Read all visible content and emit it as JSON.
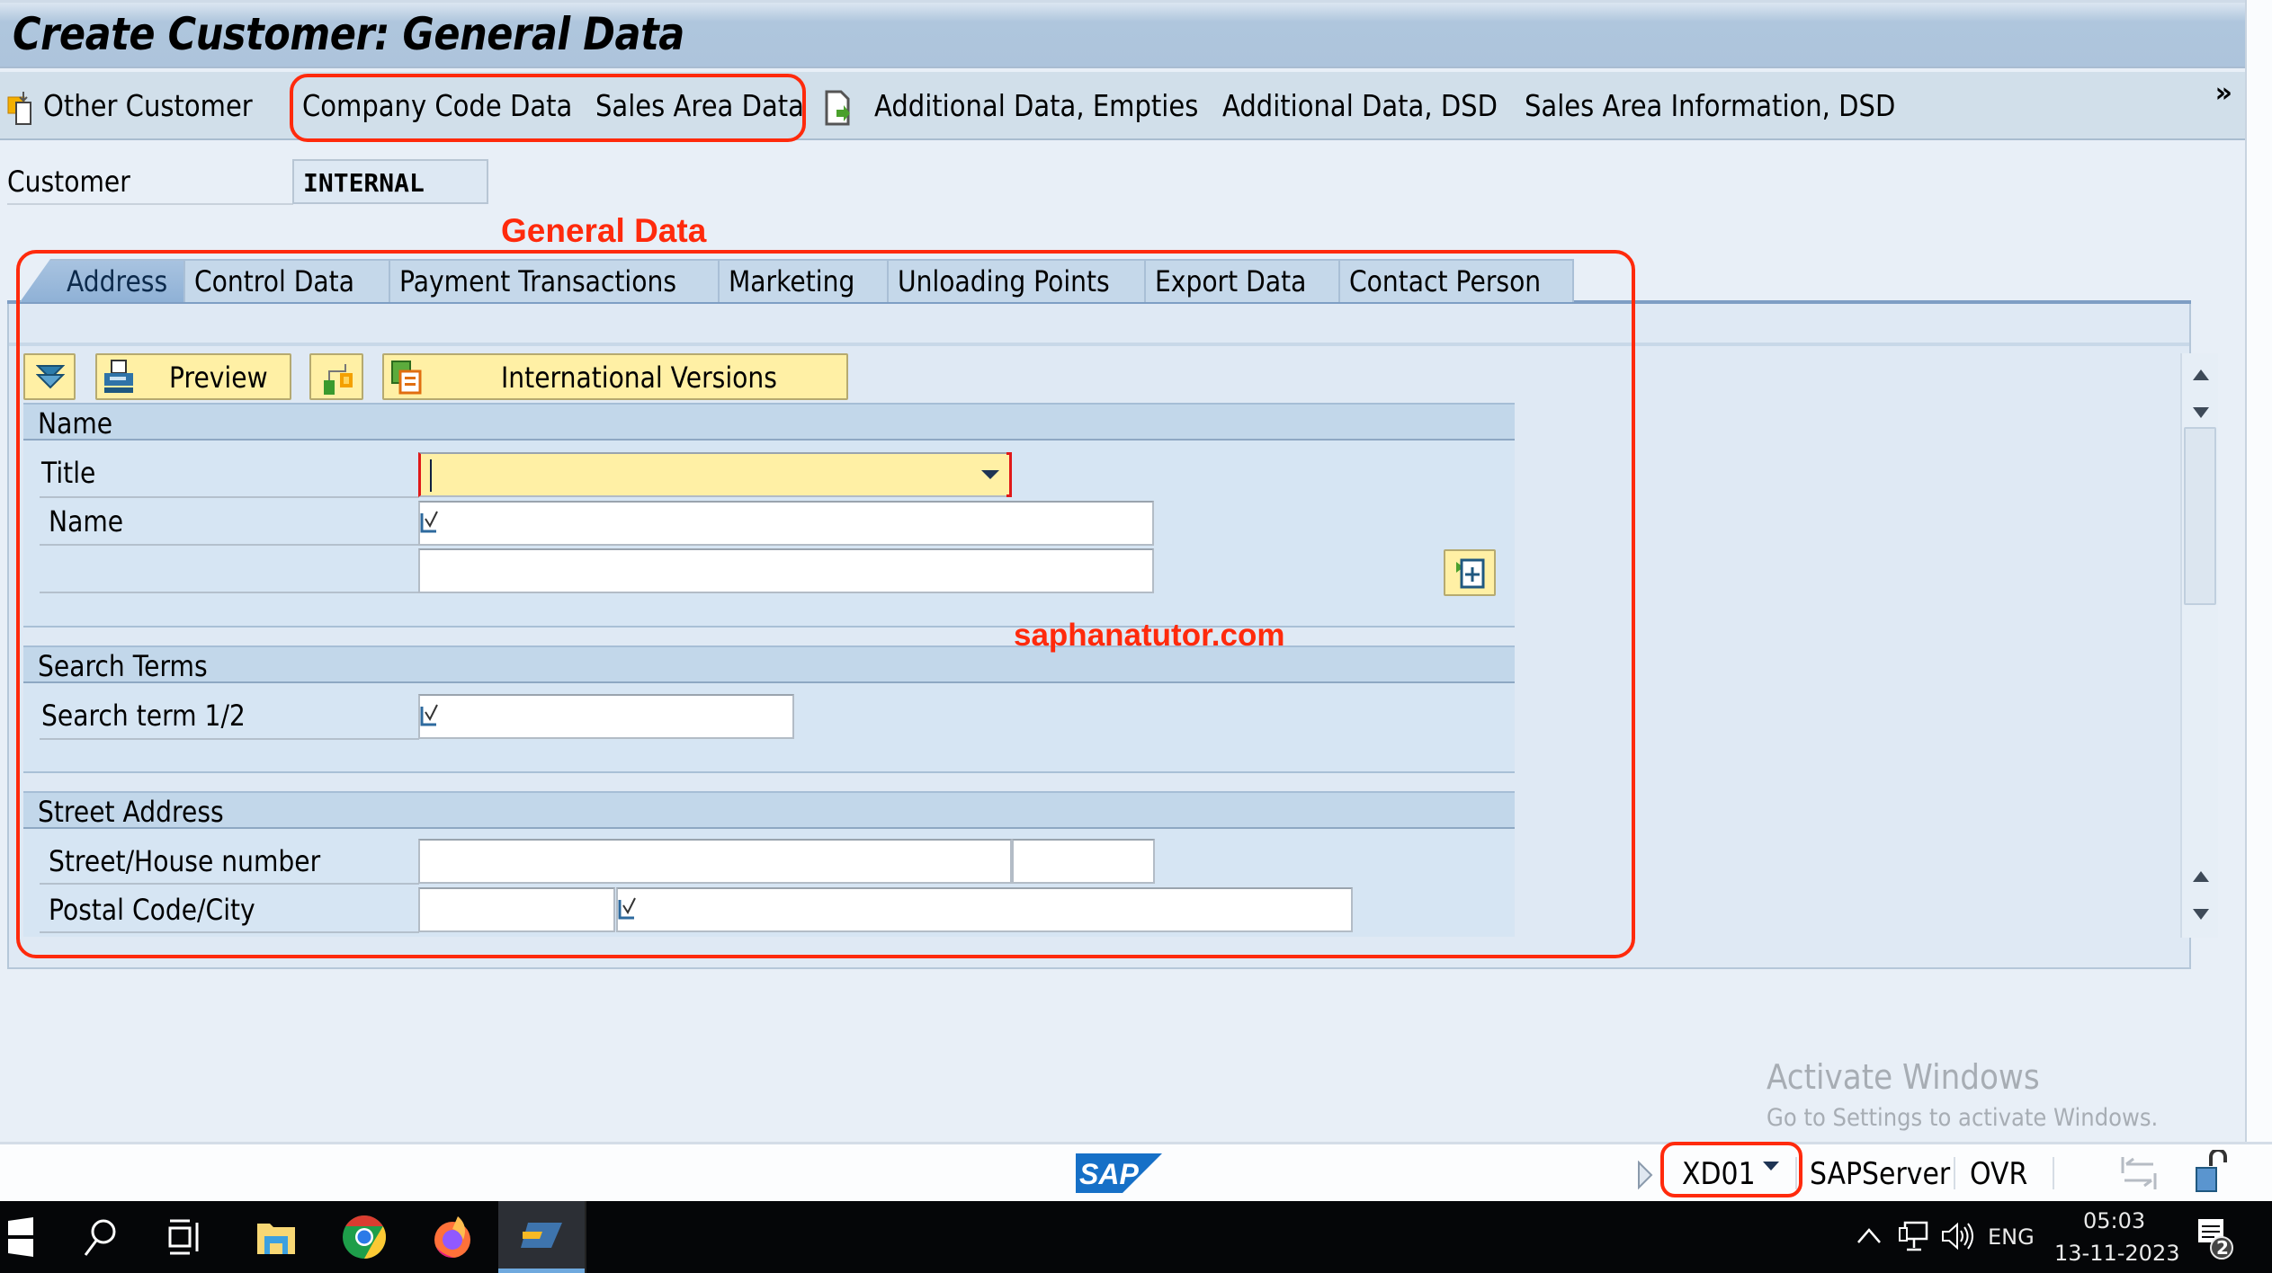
{
  "window": {
    "title": "Create Customer: General Data"
  },
  "toolbar": {
    "items": [
      {
        "label": "Other Customer",
        "icon": "other-customer-icon"
      },
      {
        "label": "Company Code Data"
      },
      {
        "label": "Sales Area Data"
      },
      {
        "label": "Additional Data, Empties",
        "icon": "document-arrow-icon"
      },
      {
        "label": "Additional Data, DSD"
      },
      {
        "label": "Sales Area Information, DSD"
      }
    ],
    "more": "»"
  },
  "header": {
    "customer_label": "Customer",
    "customer_value": "INTERNAL"
  },
  "annotations": {
    "general_data": "General Data",
    "watermark": "saphanatutor.com",
    "color": "#ff2a0c"
  },
  "tabs": [
    {
      "label": "Address",
      "active": true
    },
    {
      "label": "Control Data"
    },
    {
      "label": "Payment Transactions"
    },
    {
      "label": "Marketing"
    },
    {
      "label": "Unloading Points"
    },
    {
      "label": "Export Data"
    },
    {
      "label": "Contact Person"
    }
  ],
  "buttons": {
    "expand_icon": "expand-collapse-icon",
    "preview": "Preview",
    "org_icon": "org-structure-icon",
    "international_versions": "International Versions"
  },
  "sections": {
    "name": {
      "header": "Name",
      "title_label": "Title",
      "title_value": "",
      "name_label": "Name",
      "name_value": "",
      "name2_value": ""
    },
    "search_terms": {
      "header": "Search Terms",
      "label": "Search term 1/2",
      "value": ""
    },
    "street_address": {
      "header": "Street Address",
      "street_label": "Street/House number",
      "street_value": "",
      "house_value": "",
      "postal_label": "Postal Code/City",
      "postal_value": "",
      "city_value": ""
    }
  },
  "statusbar": {
    "logo": "SAP",
    "tcode": "XD01",
    "server": "SAPServer",
    "mode": "OVR"
  },
  "watermark": {
    "line1": "Activate Windows",
    "line2": "Go to Settings to activate Windows."
  },
  "taskbar": {
    "apps": [
      "start",
      "search",
      "task-view",
      "file-explorer",
      "chrome",
      "firefox",
      "sap-logon"
    ],
    "lang": "ENG",
    "time": "05:03",
    "date": "13-11-2023",
    "notifications": "2"
  },
  "colors": {
    "button_yellow": "#fff0a5",
    "annotation_red": "#ff2a0c",
    "active_tab": "#8fb1d6"
  }
}
